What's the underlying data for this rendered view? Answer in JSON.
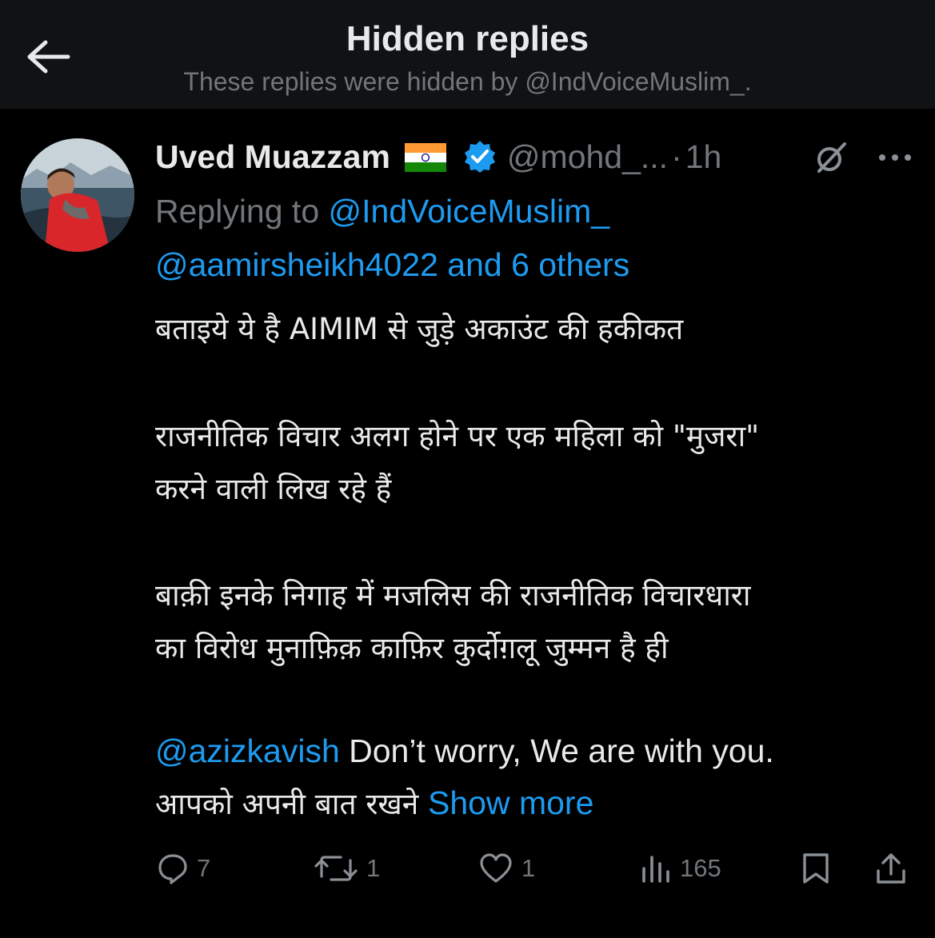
{
  "header": {
    "title": "Hidden replies",
    "subtitle": "These replies were hidden by @IndVoiceMuslim_."
  },
  "tweet": {
    "display_name": "Uved Muazzam",
    "flag_icon": "india-flag-icon",
    "handle": "@mohd_...",
    "separator": "·",
    "time": "1h",
    "replying_prefix": "Replying to",
    "replying_user": "@IndVoiceMuslim_",
    "replying_others_user": "@aamirsheikh4022",
    "replying_others_rest": " and 6 others",
    "body": {
      "line1": "बताइये ये है AIMIM से जुड़े अकाउंट की हकीकत",
      "line2": "राजनीतिक विचार अलग होने पर एक महिला को \"मुजरा\"",
      "line3": "करने वाली लिख रहे हैं",
      "line4": "बाक़ी इनके निगाह में मजलिस की राजनीतिक विचारधारा",
      "line5": "का विरोध मुनाफ़िक़ काफ़िर कुर्दोग़लू जुम्मन है ही",
      "line6_mention": "@azizkavish",
      "line6_text": " Don’t worry, We are with you.",
      "line7_text": "आपको अपनी बात रखने ",
      "show_more": "Show more"
    },
    "actions": {
      "replies": "7",
      "reposts": "1",
      "likes": "1",
      "views": "165"
    }
  },
  "colors": {
    "background": "#000000",
    "header_background": "#101214",
    "text": "#e7e9ea",
    "muted": "#71767b",
    "link": "#1d9bf0"
  },
  "icons": [
    "back-arrow-icon",
    "verified-badge-icon",
    "grok-icon",
    "more-icon",
    "reply-icon",
    "repost-icon",
    "like-icon",
    "views-icon",
    "bookmark-icon",
    "share-icon"
  ]
}
